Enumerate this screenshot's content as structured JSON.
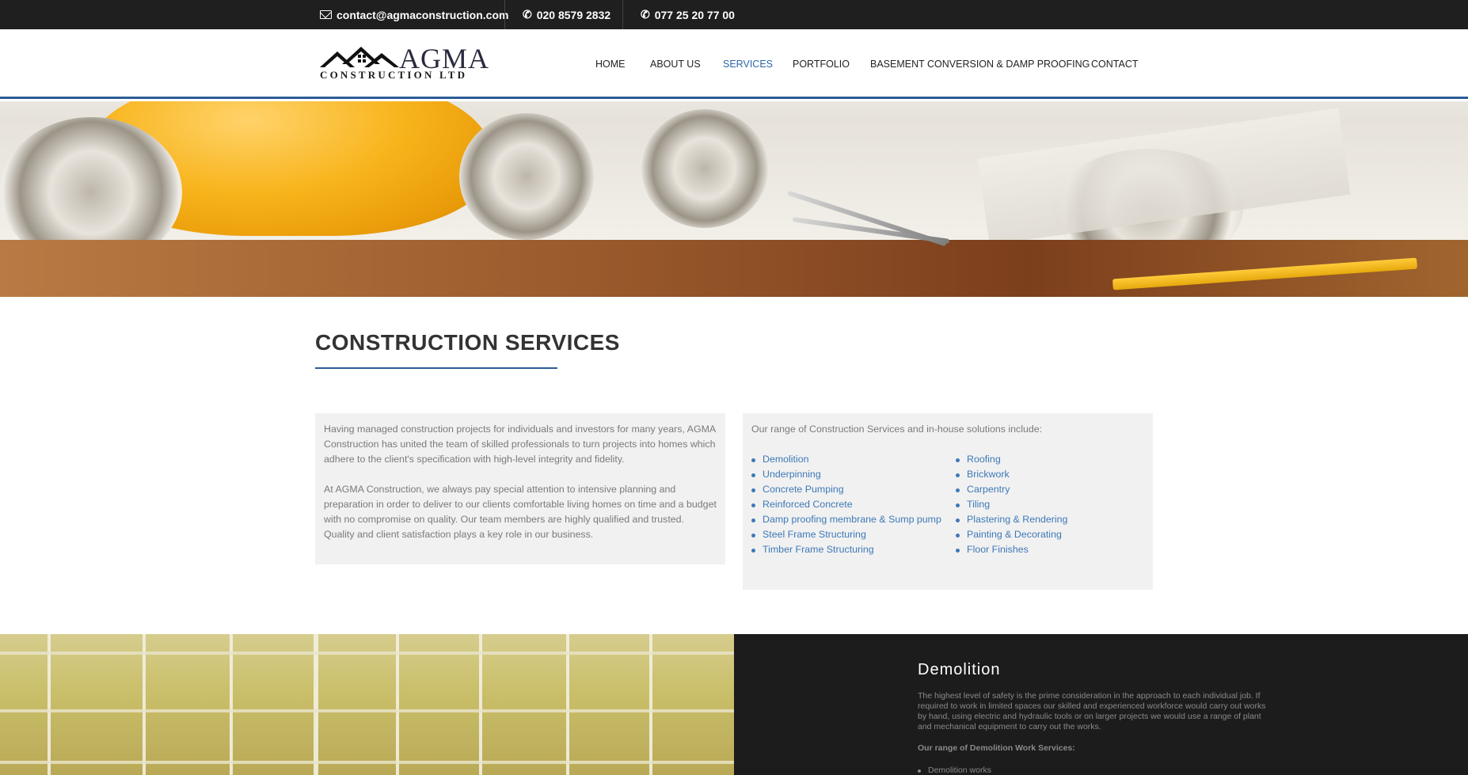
{
  "topbar": {
    "email": "contact@agmaconstruction.com",
    "phone1": "020 8579 2832",
    "phone2": "077 25 20 77 00"
  },
  "logo": {
    "name": "AGMA",
    "tagline": "CONSTRUCTION LTD"
  },
  "nav": {
    "items": [
      {
        "label": "HOME",
        "active": false
      },
      {
        "label": "ABOUT US",
        "active": false
      },
      {
        "label": "SERVICES",
        "active": true
      },
      {
        "label": "PORTFOLIO",
        "active": false
      },
      {
        "label": "BASEMENT CONVERSION & DAMP PROOFING",
        "active": false
      },
      {
        "label": "CONTACT",
        "active": false
      }
    ]
  },
  "main": {
    "title": "CONSTRUCTION SERVICES",
    "intro": [
      "Having managed construction projects for individuals and investors for many years, AGMA Construction has united the team of skilled professionals to turn projects into homes which adhere to the client's specification with high-level integrity and fidelity.",
      "At AGMA Construction, we always pay special attention to intensive planning and preparation in order to deliver to our clients comfortable living homes on time and a budget with no compromise on quality. Our team members are highly qualified and trusted. Quality and client satisfaction plays a key role in our business."
    ],
    "services_intro": "Our range of Construction Services and in-house solutions include:",
    "services_left": [
      "Demolition",
      "Underpinning",
      "Concrete Pumping",
      "Reinforced Concrete",
      "Damp proofing membrane & Sump pump",
      "Steel Frame Structuring",
      "Timber Frame Structuring"
    ],
    "services_right": [
      "Roofing",
      "Brickwork",
      "Carpentry",
      "Tiling",
      "Plastering & Rendering",
      "Painting & Decorating",
      "Floor Finishes"
    ]
  },
  "feature": {
    "title": "Demolition",
    "text": "The highest level of safety is the prime consideration in the approach to each individual job. If required to work in limited spaces our skilled and experienced workforce would carry out works by hand, using electric and hydraulic tools or on larger projects we would use a range of plant and mechanical equipment to carry out the works.",
    "subheading": "Our range of Demolition Work Services:",
    "items": [
      "Demolition works"
    ]
  },
  "colors": {
    "accent": "#2c5c96",
    "link": "#3d79b8",
    "topbar": "#1f1f1f"
  }
}
